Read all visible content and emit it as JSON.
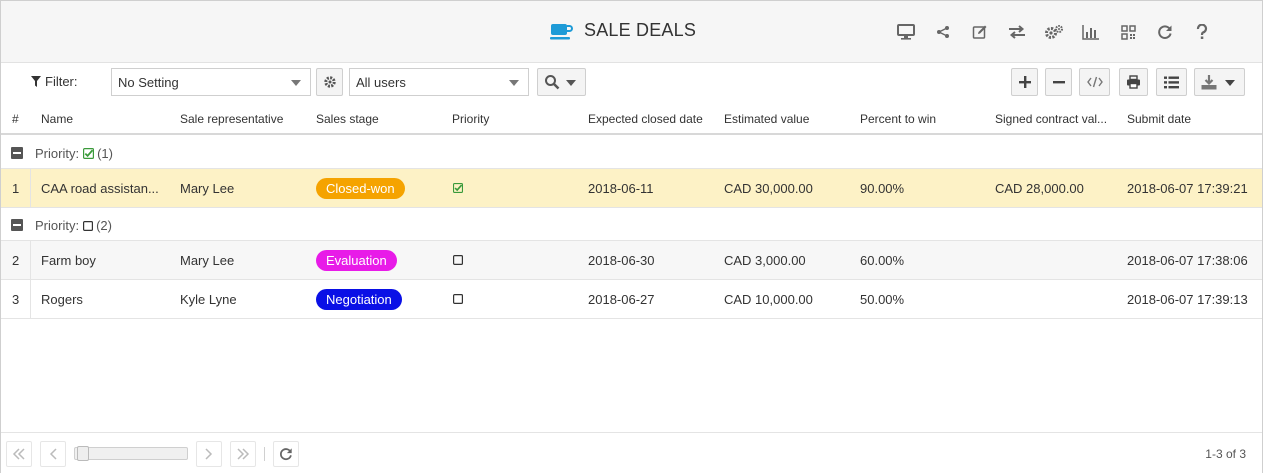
{
  "header": {
    "title": "SALE DEALS",
    "icons": [
      "monitor-icon",
      "share-icon",
      "edit-icon",
      "transfer-icon",
      "settings-icon",
      "chart-icon",
      "qr-code-icon",
      "refresh-icon",
      "help-icon"
    ]
  },
  "toolbar": {
    "filter_label": "Filter:",
    "filter_select_value": "No Setting",
    "users_select_value": "All users"
  },
  "table": {
    "columns": [
      "#",
      "Name",
      "Sale representative",
      "Sales stage",
      "Priority",
      "Expected closed date",
      "Estimated value",
      "Percent to win",
      "Signed contract val...",
      "Submit date"
    ],
    "groups": [
      {
        "label": "Priority:",
        "count": "(1)",
        "rows": [
          {
            "num": "1",
            "name": "CAA road assistan...",
            "rep": "Mary Lee",
            "stage": "Closed-won",
            "stage_color": "#f5a300",
            "priority": "checked",
            "expected": "2018-06-11",
            "estimated": "CAD 30,000.00",
            "percent": "90.00%",
            "signed": "CAD 28,000.00",
            "submit": "2018-06-07 17:39:21"
          }
        ]
      },
      {
        "label": "Priority:",
        "count": "(2)",
        "rows": [
          {
            "num": "2",
            "name": "Farm boy",
            "rep": "Mary Lee",
            "stage": "Evaluation",
            "stage_color": "#e81be8",
            "priority": "unchecked",
            "expected": "2018-06-30",
            "estimated": "CAD 3,000.00",
            "percent": "60.00%",
            "signed": "",
            "submit": "2018-06-07 17:38:06"
          },
          {
            "num": "3",
            "name": "Rogers",
            "rep": "Kyle Lyne",
            "stage": "Negotiation",
            "stage_color": "#0a10e6",
            "priority": "unchecked",
            "expected": "2018-06-27",
            "estimated": "CAD 10,000.00",
            "percent": "50.00%",
            "signed": "",
            "submit": "2018-06-07 17:39:13"
          }
        ]
      }
    ]
  },
  "footer": {
    "paging_info": "1-3 of 3"
  },
  "colors": {
    "accent": "#1e9bd7",
    "selected_row": "#fdf2c6",
    "check_green": "#3a9a3a"
  }
}
